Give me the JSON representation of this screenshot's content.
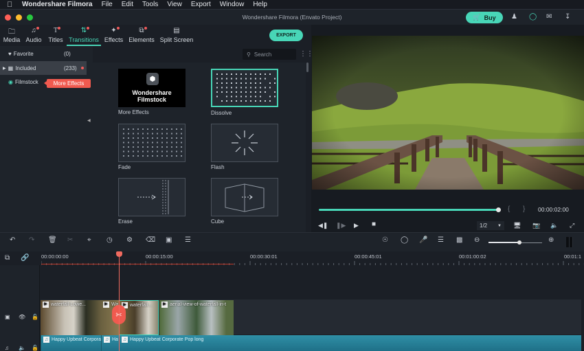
{
  "menubar": {
    "apple_icon": "apple-icon",
    "app_name": "Wondershare Filmora",
    "items": [
      "File",
      "Edit",
      "Tools",
      "View",
      "Export",
      "Window",
      "Help"
    ]
  },
  "titlebar": {
    "title": "Wondershare Filmora (Envato Project)",
    "buy_label": "Buy",
    "icons": [
      "account-icon",
      "support-icon",
      "mail-icon",
      "download-icon"
    ]
  },
  "tabs": [
    {
      "label": "Media",
      "icon": "folder-icon",
      "badge": false
    },
    {
      "label": "Audio",
      "icon": "music-icon",
      "badge": true
    },
    {
      "label": "Titles",
      "icon": "text-icon",
      "badge": true
    },
    {
      "label": "Transitions",
      "icon": "transition-icon",
      "badge": true,
      "active": true
    },
    {
      "label": "Effects",
      "icon": "effects-icon",
      "badge": true
    },
    {
      "label": "Elements",
      "icon": "elements-icon",
      "badge": true
    },
    {
      "label": "Split Screen",
      "icon": "split-screen-icon",
      "badge": false
    }
  ],
  "export_label": "EXPORT",
  "sidebar": {
    "items": [
      {
        "label": "Favorite",
        "count": "(0)",
        "icon": "heart-icon"
      },
      {
        "label": "Included",
        "count": "(233)",
        "icon": "grid-icon",
        "selected": true
      },
      {
        "label": "Filmstock",
        "count": "",
        "icon": "filmstock-icon"
      }
    ],
    "tooltip": "More Effects"
  },
  "search": {
    "placeholder": "Search"
  },
  "transitions": [
    {
      "name": "More Effects",
      "thumb_text": [
        "Wondershare",
        "Filmstock"
      ]
    },
    {
      "name": "Dissolve",
      "selected": true
    },
    {
      "name": "Fade"
    },
    {
      "name": "Flash"
    },
    {
      "name": "Erase"
    },
    {
      "name": "Cube"
    }
  ],
  "player": {
    "progress": 1.0,
    "timecode": "00:00:02:00",
    "quality": "1/2",
    "mark_in": "{",
    "mark_out": "}"
  },
  "timeline": {
    "zoom_level": 0.58,
    "ruler_labels": [
      "00:00:00:00",
      "00:00:15:00",
      "00:00:30:01",
      "00:00:45:01",
      "00:01:00:02",
      "00:01:1"
    ],
    "video_clips": [
      {
        "label": "waterfall-Lowe..."
      },
      {
        "label": "Wa..."
      },
      {
        "label": "waterfall..."
      },
      {
        "label": "aerial-view-of-waterfall-in-t"
      }
    ],
    "audio_clips": [
      {
        "label": "Happy Upbeat Corpora"
      },
      {
        "label": "Ha"
      },
      {
        "label": "Happy Upbeat Corporate Pop long"
      }
    ]
  },
  "colors": {
    "accent": "#48d6b7",
    "playhead": "#f06a5f",
    "badge": "#ef5a5a",
    "audio": "#2f8fa6"
  }
}
